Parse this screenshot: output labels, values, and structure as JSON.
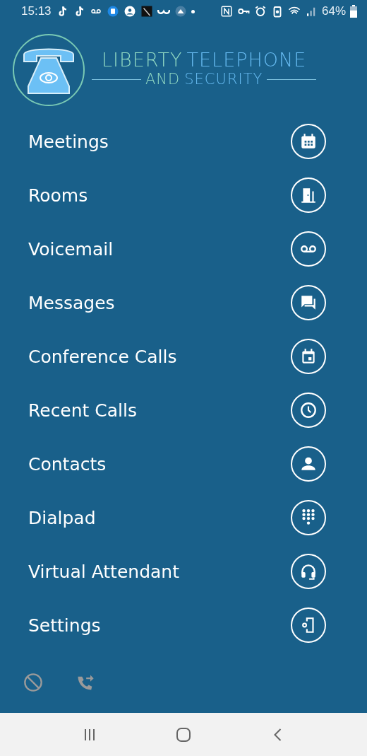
{
  "status_bar": {
    "time": "15:13",
    "battery_text": "64%"
  },
  "logo": {
    "word_1": "LIBERTY",
    "word_2": "TELEPHONE",
    "word_3": "AND",
    "word_4": "SECURITY"
  },
  "menu": [
    {
      "label": "Meetings"
    },
    {
      "label": "Rooms"
    },
    {
      "label": "Voicemail"
    },
    {
      "label": "Messages"
    },
    {
      "label": "Conference Calls"
    },
    {
      "label": "Recent Calls"
    },
    {
      "label": "Contacts"
    },
    {
      "label": "Dialpad"
    },
    {
      "label": "Virtual Attendant"
    },
    {
      "label": "Settings"
    }
  ],
  "footer": {
    "do_not_disturb": {
      "on": false
    },
    "call_forward": {
      "on": false
    }
  }
}
